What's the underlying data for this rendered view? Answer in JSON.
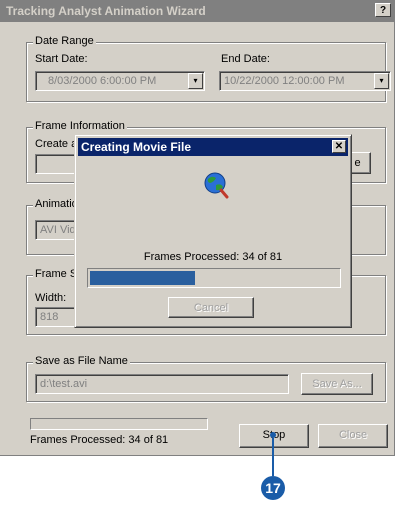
{
  "window": {
    "title": "Tracking Analyst Animation Wizard",
    "help_label": "?"
  },
  "date_range": {
    "group_label": "Date Range",
    "start_label": "Start Date:",
    "start_value": "8/03/2000  6:00:00 PM",
    "end_label": "End Date:",
    "end_value": "10/22/2000 12:00:00 PM",
    "dropdown_glyph": "▾"
  },
  "frame_info": {
    "group_label": "Frame Information",
    "create_label_fragment": "Create a",
    "button_fragment": "e"
  },
  "animation": {
    "group_label_fragment": "Animation",
    "format_fragment": "AVI Vid"
  },
  "frame_size": {
    "group_label_fragment": "Frame Si",
    "width_label": "Width:",
    "width_value": "818"
  },
  "save": {
    "group_label": "Save as File Name",
    "file_value": "d:\\test.avi",
    "save_as_label": "Save As..."
  },
  "status": {
    "frames_processed": "Frames Processed: 34 of 81",
    "progress_fraction": 0
  },
  "buttons": {
    "stop_label": "Stop",
    "close_label": "Close"
  },
  "dialog": {
    "title": "Creating Movie File",
    "close_glyph": "✕",
    "frames_processed": "Frames Processed: 34 of 81",
    "progress_fraction": 0.42,
    "cancel_label": "Cancel"
  },
  "callout": {
    "number": "17"
  }
}
